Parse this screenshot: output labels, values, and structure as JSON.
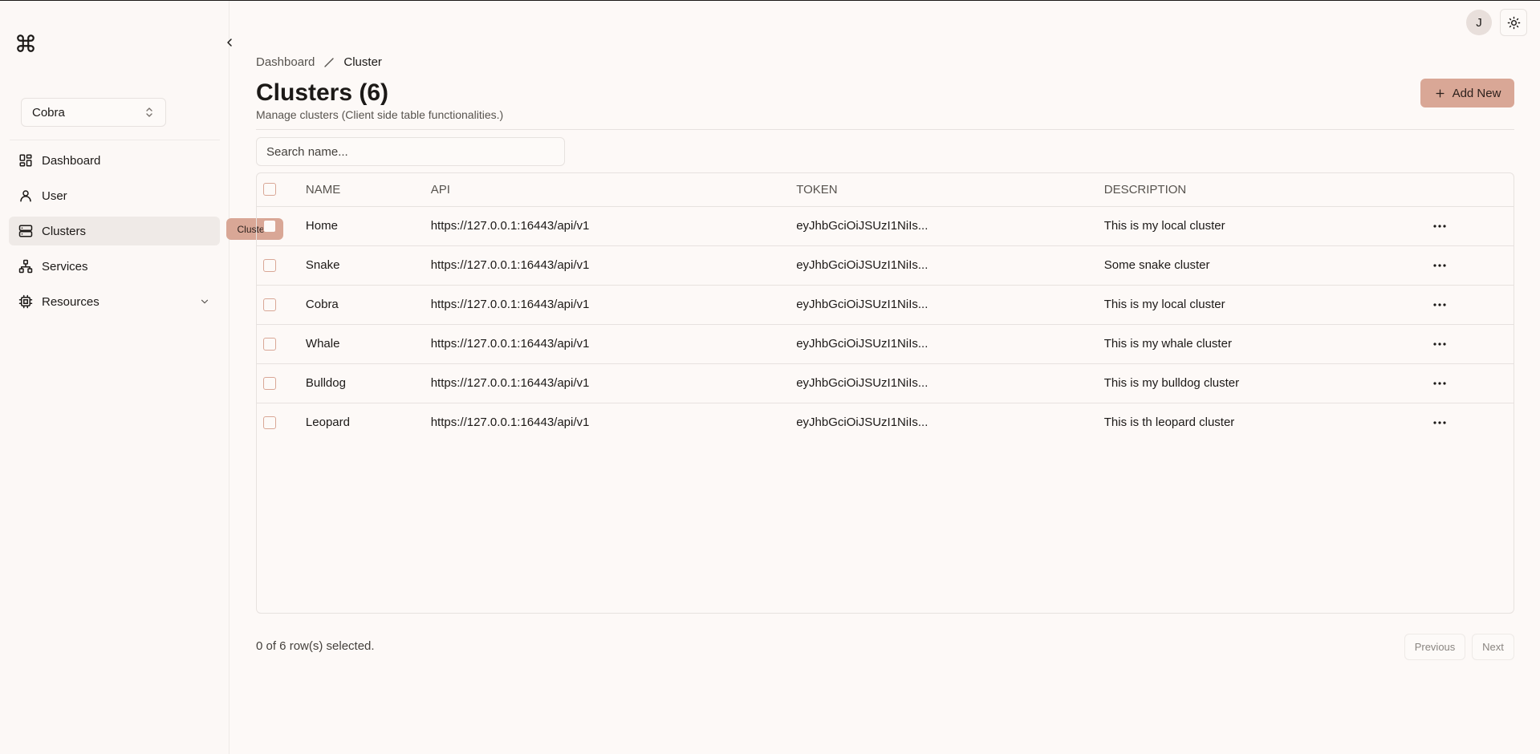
{
  "sidebar": {
    "team": "Cobra",
    "items": [
      {
        "label": "Dashboard"
      },
      {
        "label": "User"
      },
      {
        "label": "Clusters"
      },
      {
        "label": "Services"
      },
      {
        "label": "Resources"
      }
    ],
    "tooltip": "Clusters"
  },
  "header": {
    "avatar_initial": "J"
  },
  "breadcrumb": {
    "parent": "Dashboard",
    "current": "Cluster"
  },
  "page": {
    "title": "Clusters (6)",
    "subtitle": "Manage clusters (Client side table functionalities.)",
    "add_label": "Add New"
  },
  "search": {
    "placeholder": "Search name..."
  },
  "table": {
    "columns": [
      "NAME",
      "API",
      "TOKEN",
      "DESCRIPTION"
    ],
    "rows": [
      {
        "name": "Home",
        "api": "https://127.0.0.1:16443/api/v1",
        "token": "eyJhbGciOiJSUzI1NiIs...",
        "description": "This is my local cluster"
      },
      {
        "name": "Snake",
        "api": "https://127.0.0.1:16443/api/v1",
        "token": "eyJhbGciOiJSUzI1NiIs...",
        "description": "Some snake cluster"
      },
      {
        "name": "Cobra",
        "api": "https://127.0.0.1:16443/api/v1",
        "token": "eyJhbGciOiJSUzI1NiIs...",
        "description": "This is my local cluster"
      },
      {
        "name": "Whale",
        "api": "https://127.0.0.1:16443/api/v1",
        "token": "eyJhbGciOiJSUzI1NiIs...",
        "description": "This is my whale cluster"
      },
      {
        "name": "Bulldog",
        "api": "https://127.0.0.1:16443/api/v1",
        "token": "eyJhbGciOiJSUzI1NiIs...",
        "description": "This is my bulldog cluster"
      },
      {
        "name": "Leopard",
        "api": "https://127.0.0.1:16443/api/v1",
        "token": "eyJhbGciOiJSUzI1NiIs...",
        "description": "This is th leopard cluster"
      }
    ]
  },
  "footer": {
    "selection": "0 of 6 row(s) selected.",
    "previous": "Previous",
    "next": "Next"
  },
  "colors": {
    "accent": "#d9a796",
    "background": "#fdf9f7",
    "active_nav": "#efeae7",
    "border": "#e7e2df"
  },
  "icons": [
    "command-icon",
    "chevron-left-icon",
    "chevron-up-down-icon",
    "dashboard-icon",
    "user-icon",
    "server-icon",
    "network-icon",
    "cpu-icon",
    "chevron-down-icon",
    "sun-icon",
    "plus-icon",
    "slash-icon",
    "more-horizontal-icon"
  ]
}
